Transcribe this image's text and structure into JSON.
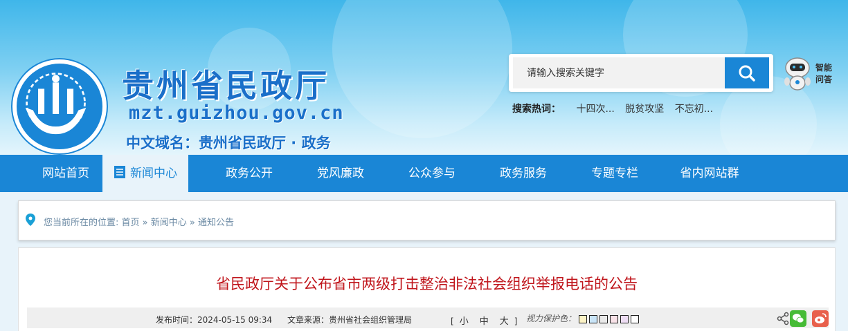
{
  "header": {
    "site_title": "贵州省民政厅",
    "domain": "mzt.guizhou.gov.cn",
    "cn_domain": "中文域名：贵州省民政厅 · 政务",
    "search": {
      "placeholder": "请输入搜索关键字",
      "hot_label": "搜索热词：",
      "hot_words": [
        "十四次...",
        "脱贫攻坚",
        "不忘初..."
      ]
    },
    "assistant_label": "智能问答"
  },
  "nav": {
    "items": [
      {
        "label": "网站首页"
      },
      {
        "label": "新闻中心"
      },
      {
        "label": "政务公开"
      },
      {
        "label": "党风廉政"
      },
      {
        "label": "公众参与"
      },
      {
        "label": "政务服务"
      },
      {
        "label": "专题专栏"
      },
      {
        "label": "省内网站群"
      }
    ]
  },
  "breadcrumb": {
    "prefix": "您当前所在的位置: ",
    "items": [
      "首页",
      "新闻中心",
      "通知公告"
    ],
    "separator": " » "
  },
  "article": {
    "title": "省民政厅关于公布省市两级打击整治非法社会组织举报电话的公告",
    "publish_label": "发布时间：",
    "publish_time": "2024-05-15 09:34",
    "source_label": "文章来源：",
    "source": "贵州省社会组织管理局",
    "font_size": {
      "open": "[",
      "small": "小",
      "medium": "中",
      "large": "大",
      "close": "]"
    },
    "vision_label": "视力保护色：",
    "vision_colors": [
      "#fcf3c6",
      "#c9e4f7",
      "#e9e9e9",
      "#f8e2e8",
      "#eeddf4",
      "#ffffff"
    ]
  },
  "colors": {
    "primary": "#1a86d6",
    "title_red": "#c0161c",
    "wechat": "#46bb36",
    "weibo": "#e8604c"
  }
}
